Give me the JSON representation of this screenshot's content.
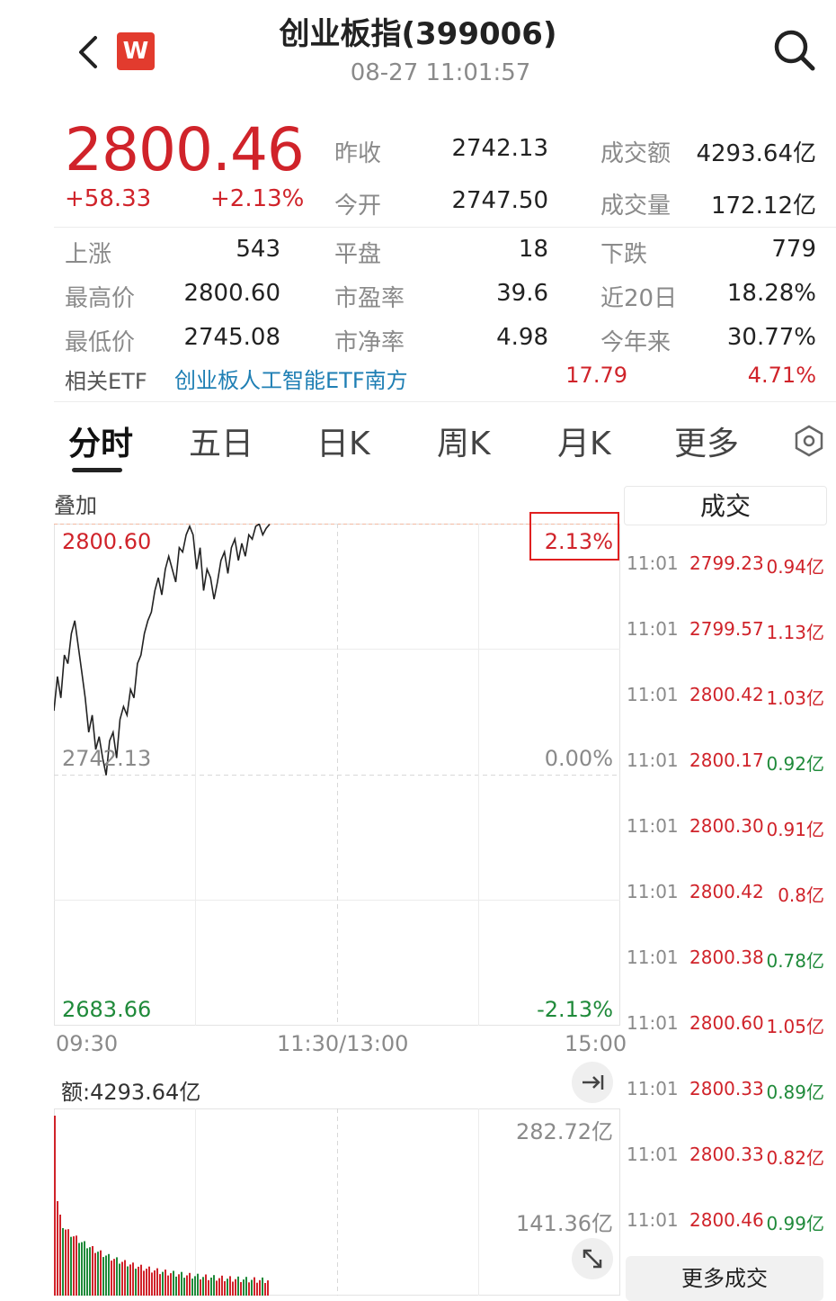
{
  "header": {
    "title": "创业板指(399006)",
    "timestamp": "08-27 11:01:57",
    "logo_letter": "W",
    "icons": [
      "back-arrow-icon",
      "search-icon"
    ]
  },
  "quote": {
    "price": "2800.46",
    "change": "+58.33",
    "change_pct": "+2.13%",
    "prev_close_label": "昨收",
    "prev_close": "2742.13",
    "open_label": "今开",
    "open": "2747.50",
    "turnover_label": "成交额",
    "turnover": "4293.64亿",
    "volume_label": "成交量",
    "volume": "172.12亿",
    "rise_label": "上涨",
    "rise": "543",
    "flat_label": "平盘",
    "flat": "18",
    "fall_label": "下跌",
    "fall": "779",
    "high_label": "最高价",
    "high": "2800.60",
    "pe_label": "市盈率",
    "pe": "39.6",
    "d20_label": "近20日",
    "d20": "18.28%",
    "low_label": "最低价",
    "low": "2745.08",
    "pb_label": "市净率",
    "pb": "4.98",
    "ytd_label": "今年来",
    "ytd": "30.77%"
  },
  "etf": {
    "label": "相关ETF",
    "name": "创业板人工智能ETF南方",
    "price": "17.79",
    "pct": "4.71%"
  },
  "tabs": [
    "分时",
    "五日",
    "日K",
    "周K",
    "月K",
    "更多"
  ],
  "chart_data": {
    "type": "line",
    "overlay_label": "叠加",
    "y_top": "2800.60",
    "y_mid": "2742.13",
    "y_bottom": "2683.66",
    "pct_top": "2.13%",
    "pct_mid": "0.00%",
    "pct_bottom": "-2.13%",
    "x_labels": [
      "09:30",
      "11:30/13:00",
      "15:00"
    ],
    "ylim": [
      2683.66,
      2800.6
    ],
    "values": [
      2757,
      2765,
      2760,
      2770,
      2768,
      2775,
      2778,
      2772,
      2766,
      2760,
      2752,
      2756,
      2748,
      2751,
      2746,
      2742,
      2750,
      2752,
      2746,
      2755,
      2758,
      2756,
      2762,
      2760,
      2768,
      2770,
      2775,
      2778,
      2780,
      2785,
      2788,
      2784,
      2790,
      2793,
      2790,
      2787,
      2795,
      2794,
      2798,
      2800,
      2798,
      2790,
      2795,
      2785,
      2790,
      2788,
      2783,
      2787,
      2792,
      2794,
      2789,
      2795,
      2797,
      2792,
      2796,
      2793,
      2798,
      2797,
      2800,
      2800.5,
      2798,
      2799.5,
      2800.46
    ],
    "volume_label": "额:4293.64亿",
    "volume_max": "282.72亿",
    "volume_mid": "141.36亿"
  },
  "trades": {
    "header": "成交",
    "more_label": "更多成交",
    "rows": [
      {
        "time": "11:01",
        "price": "2799.23",
        "vol": "0.94亿",
        "dir": "red"
      },
      {
        "time": "11:01",
        "price": "2799.57",
        "vol": "1.13亿",
        "dir": "red"
      },
      {
        "time": "11:01",
        "price": "2800.42",
        "vol": "1.03亿",
        "dir": "red"
      },
      {
        "time": "11:01",
        "price": "2800.17",
        "vol": "0.92亿",
        "dir": "green"
      },
      {
        "time": "11:01",
        "price": "2800.30",
        "vol": "0.91亿",
        "dir": "red"
      },
      {
        "time": "11:01",
        "price": "2800.42",
        "vol": "0.8亿",
        "dir": "red"
      },
      {
        "time": "11:01",
        "price": "2800.38",
        "vol": "0.78亿",
        "dir": "green"
      },
      {
        "time": "11:01",
        "price": "2800.60",
        "vol": "1.05亿",
        "dir": "red"
      },
      {
        "time": "11:01",
        "price": "2800.33",
        "vol": "0.89亿",
        "dir": "green"
      },
      {
        "time": "11:01",
        "price": "2800.33",
        "vol": "0.82亿",
        "dir": "red"
      },
      {
        "time": "11:01",
        "price": "2800.46",
        "vol": "0.99亿",
        "dir": "green"
      }
    ]
  },
  "colors": {
    "up": "#d0232a",
    "down": "#1f8a3a",
    "highlight_box": "#e02020"
  }
}
